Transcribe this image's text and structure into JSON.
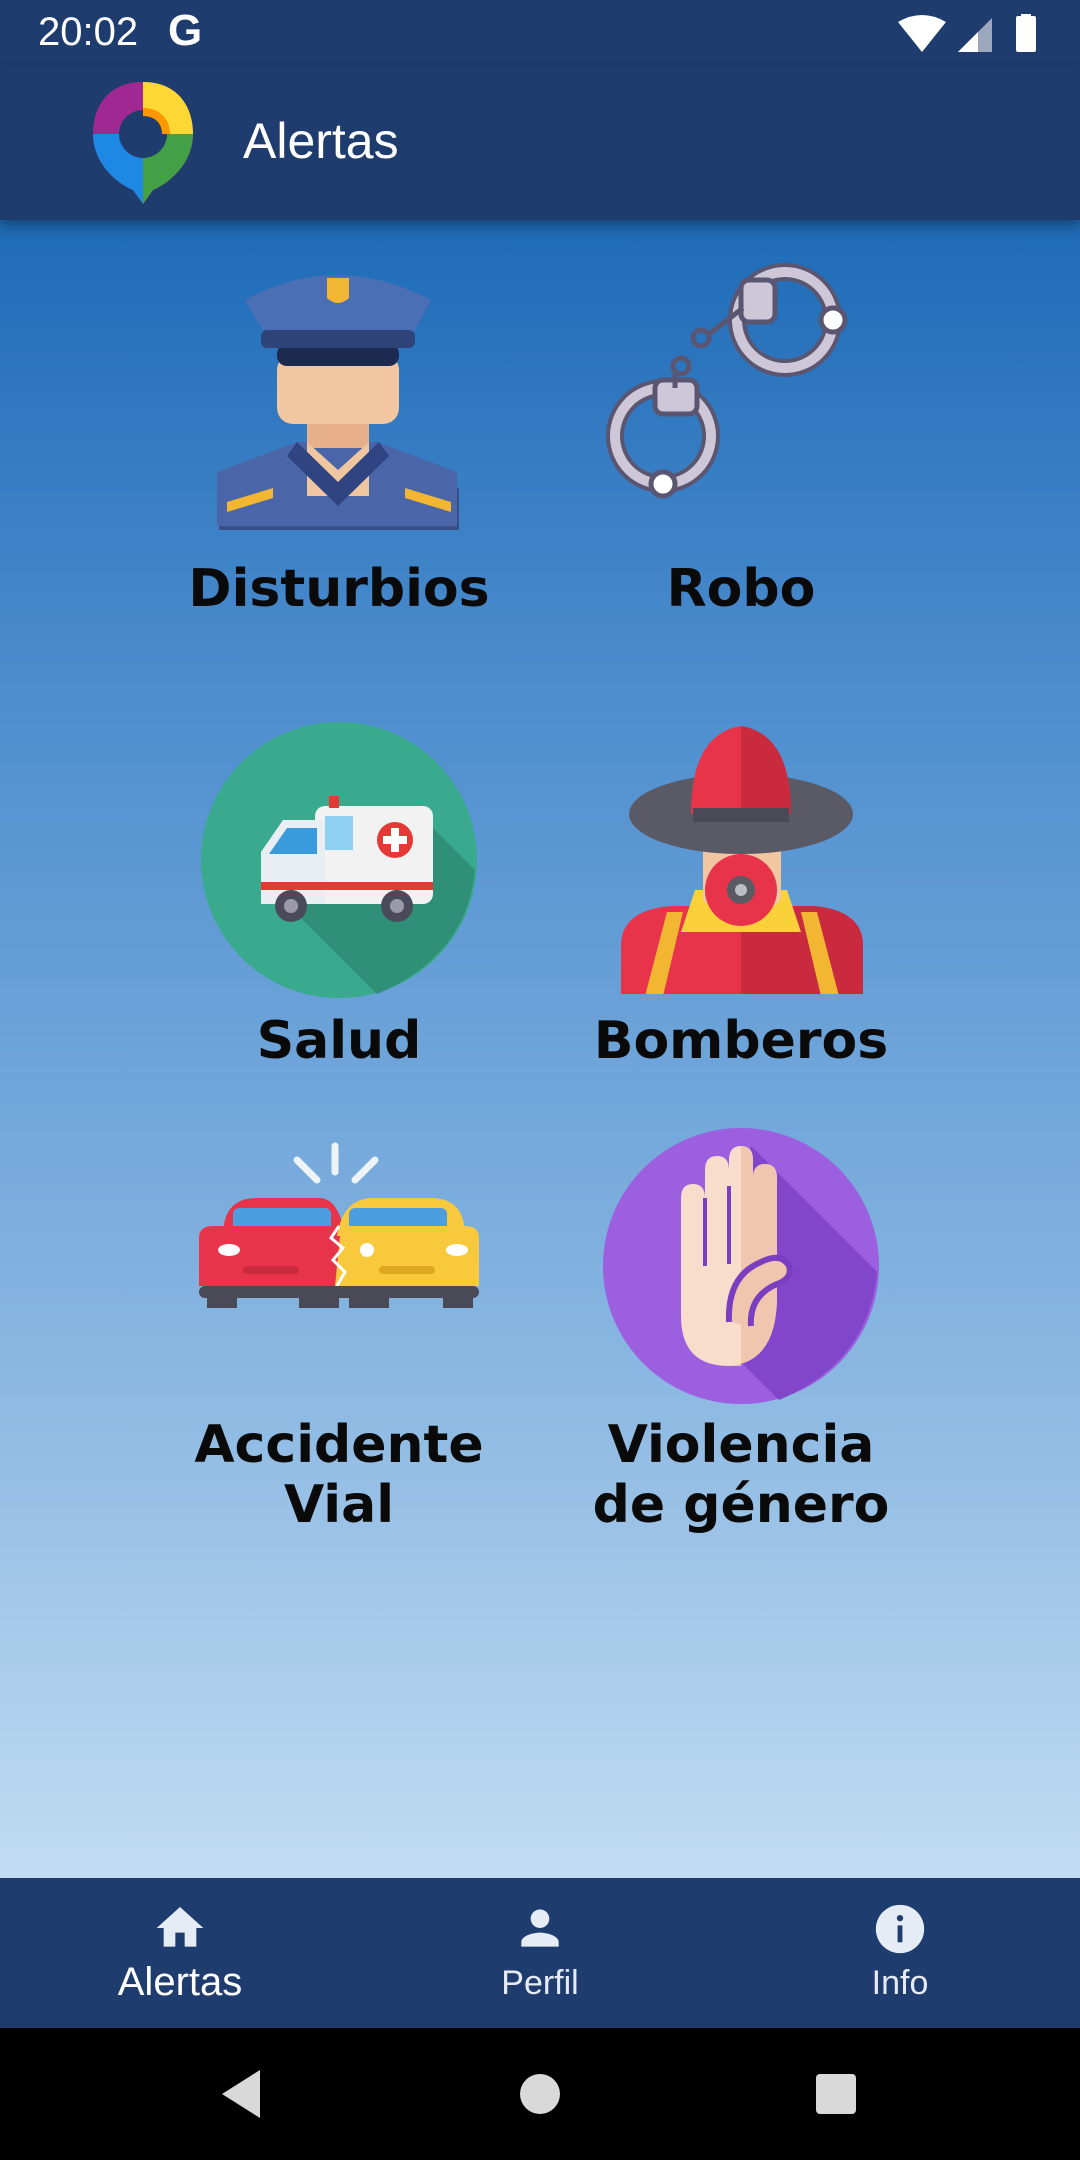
{
  "status_bar": {
    "time": "20:02",
    "g_icon": "G",
    "icons": [
      "wifi-icon",
      "signal-icon",
      "battery-icon"
    ]
  },
  "app_bar": {
    "title": "Alertas",
    "logo": "app-logo"
  },
  "tiles": [
    {
      "label": "Disturbios",
      "icon": "police-officer-icon"
    },
    {
      "label": "Robo",
      "icon": "handcuffs-icon"
    },
    {
      "label": "Salud",
      "icon": "ambulance-icon"
    },
    {
      "label": "Bomberos",
      "icon": "firefighter-icon"
    },
    {
      "label_line1": "Accidente",
      "label_line2": "Vial",
      "icon": "car-crash-icon"
    },
    {
      "label_line1": "Violencia",
      "label_line2": "de género",
      "icon": "stop-hand-icon"
    }
  ],
  "bottom_nav": {
    "items": [
      {
        "label": "Alertas",
        "icon": "home-icon",
        "active": true
      },
      {
        "label": "Perfil",
        "icon": "person-icon",
        "active": false
      },
      {
        "label": "Info",
        "icon": "info-icon",
        "active": false
      }
    ]
  },
  "system_nav": [
    "back-icon",
    "home-circle-icon",
    "recents-icon"
  ],
  "colors": {
    "app_bar": "#1f3c6e",
    "gradient_top": "#1e6bb7",
    "gradient_bottom": "#c2dcf2"
  }
}
